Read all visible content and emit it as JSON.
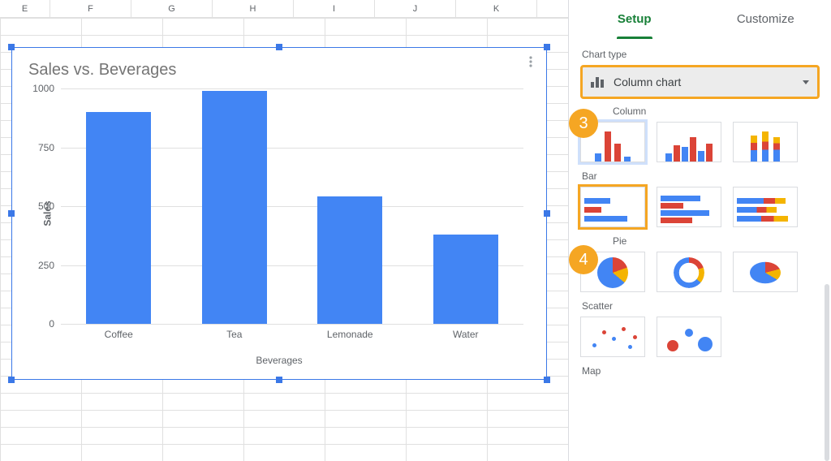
{
  "sheet": {
    "columns": [
      "E",
      "F",
      "G",
      "H",
      "I",
      "J",
      "K"
    ]
  },
  "chart_data": {
    "type": "bar",
    "title": "Sales vs. Beverages",
    "xlabel": "Beverages",
    "ylabel": "Sales",
    "categories": [
      "Coffee",
      "Tea",
      "Lemonade",
      "Water"
    ],
    "values": [
      900,
      990,
      540,
      380
    ],
    "ylim": [
      0,
      1000
    ],
    "yticks": [
      0,
      250,
      500,
      750,
      1000
    ]
  },
  "sidebar": {
    "tabs": {
      "setup": "Setup",
      "customize": "Customize",
      "active": "setup"
    },
    "chart_type_label": "Chart type",
    "chart_type_value": "Column chart",
    "groups": {
      "column": "Column",
      "bar": "Bar",
      "pie": "Pie",
      "scatter": "Scatter",
      "map": "Map"
    },
    "callouts": {
      "step3": "3",
      "step4": "4"
    }
  }
}
